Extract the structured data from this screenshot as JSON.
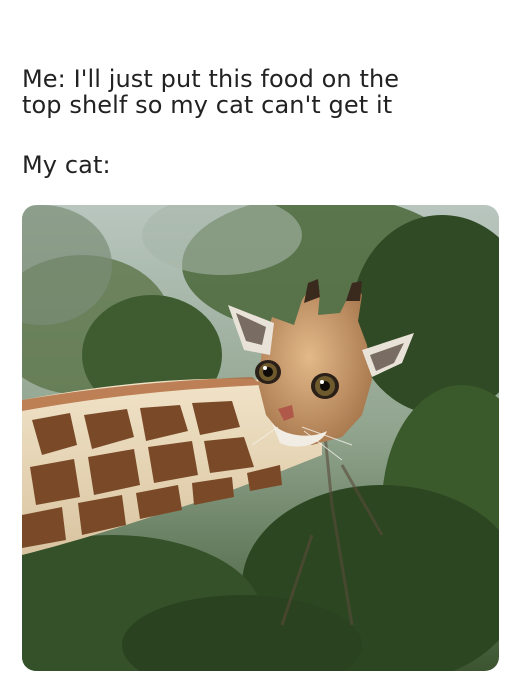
{
  "meme": {
    "setup_line_1": "Me: I'll just put this food on the",
    "setup_line_2": "top shelf so my cat can't get it",
    "punchline": "My cat:"
  },
  "photo": {
    "subject": "giraffe-neck-with-cat-face",
    "colors": {
      "foliage_dark": "#2f4a24",
      "foliage_light": "#8aa07a",
      "giraffe_base": "#e9d9bd",
      "giraffe_spot": "#7a4a28",
      "cat_fur": "#c99a6a"
    }
  }
}
